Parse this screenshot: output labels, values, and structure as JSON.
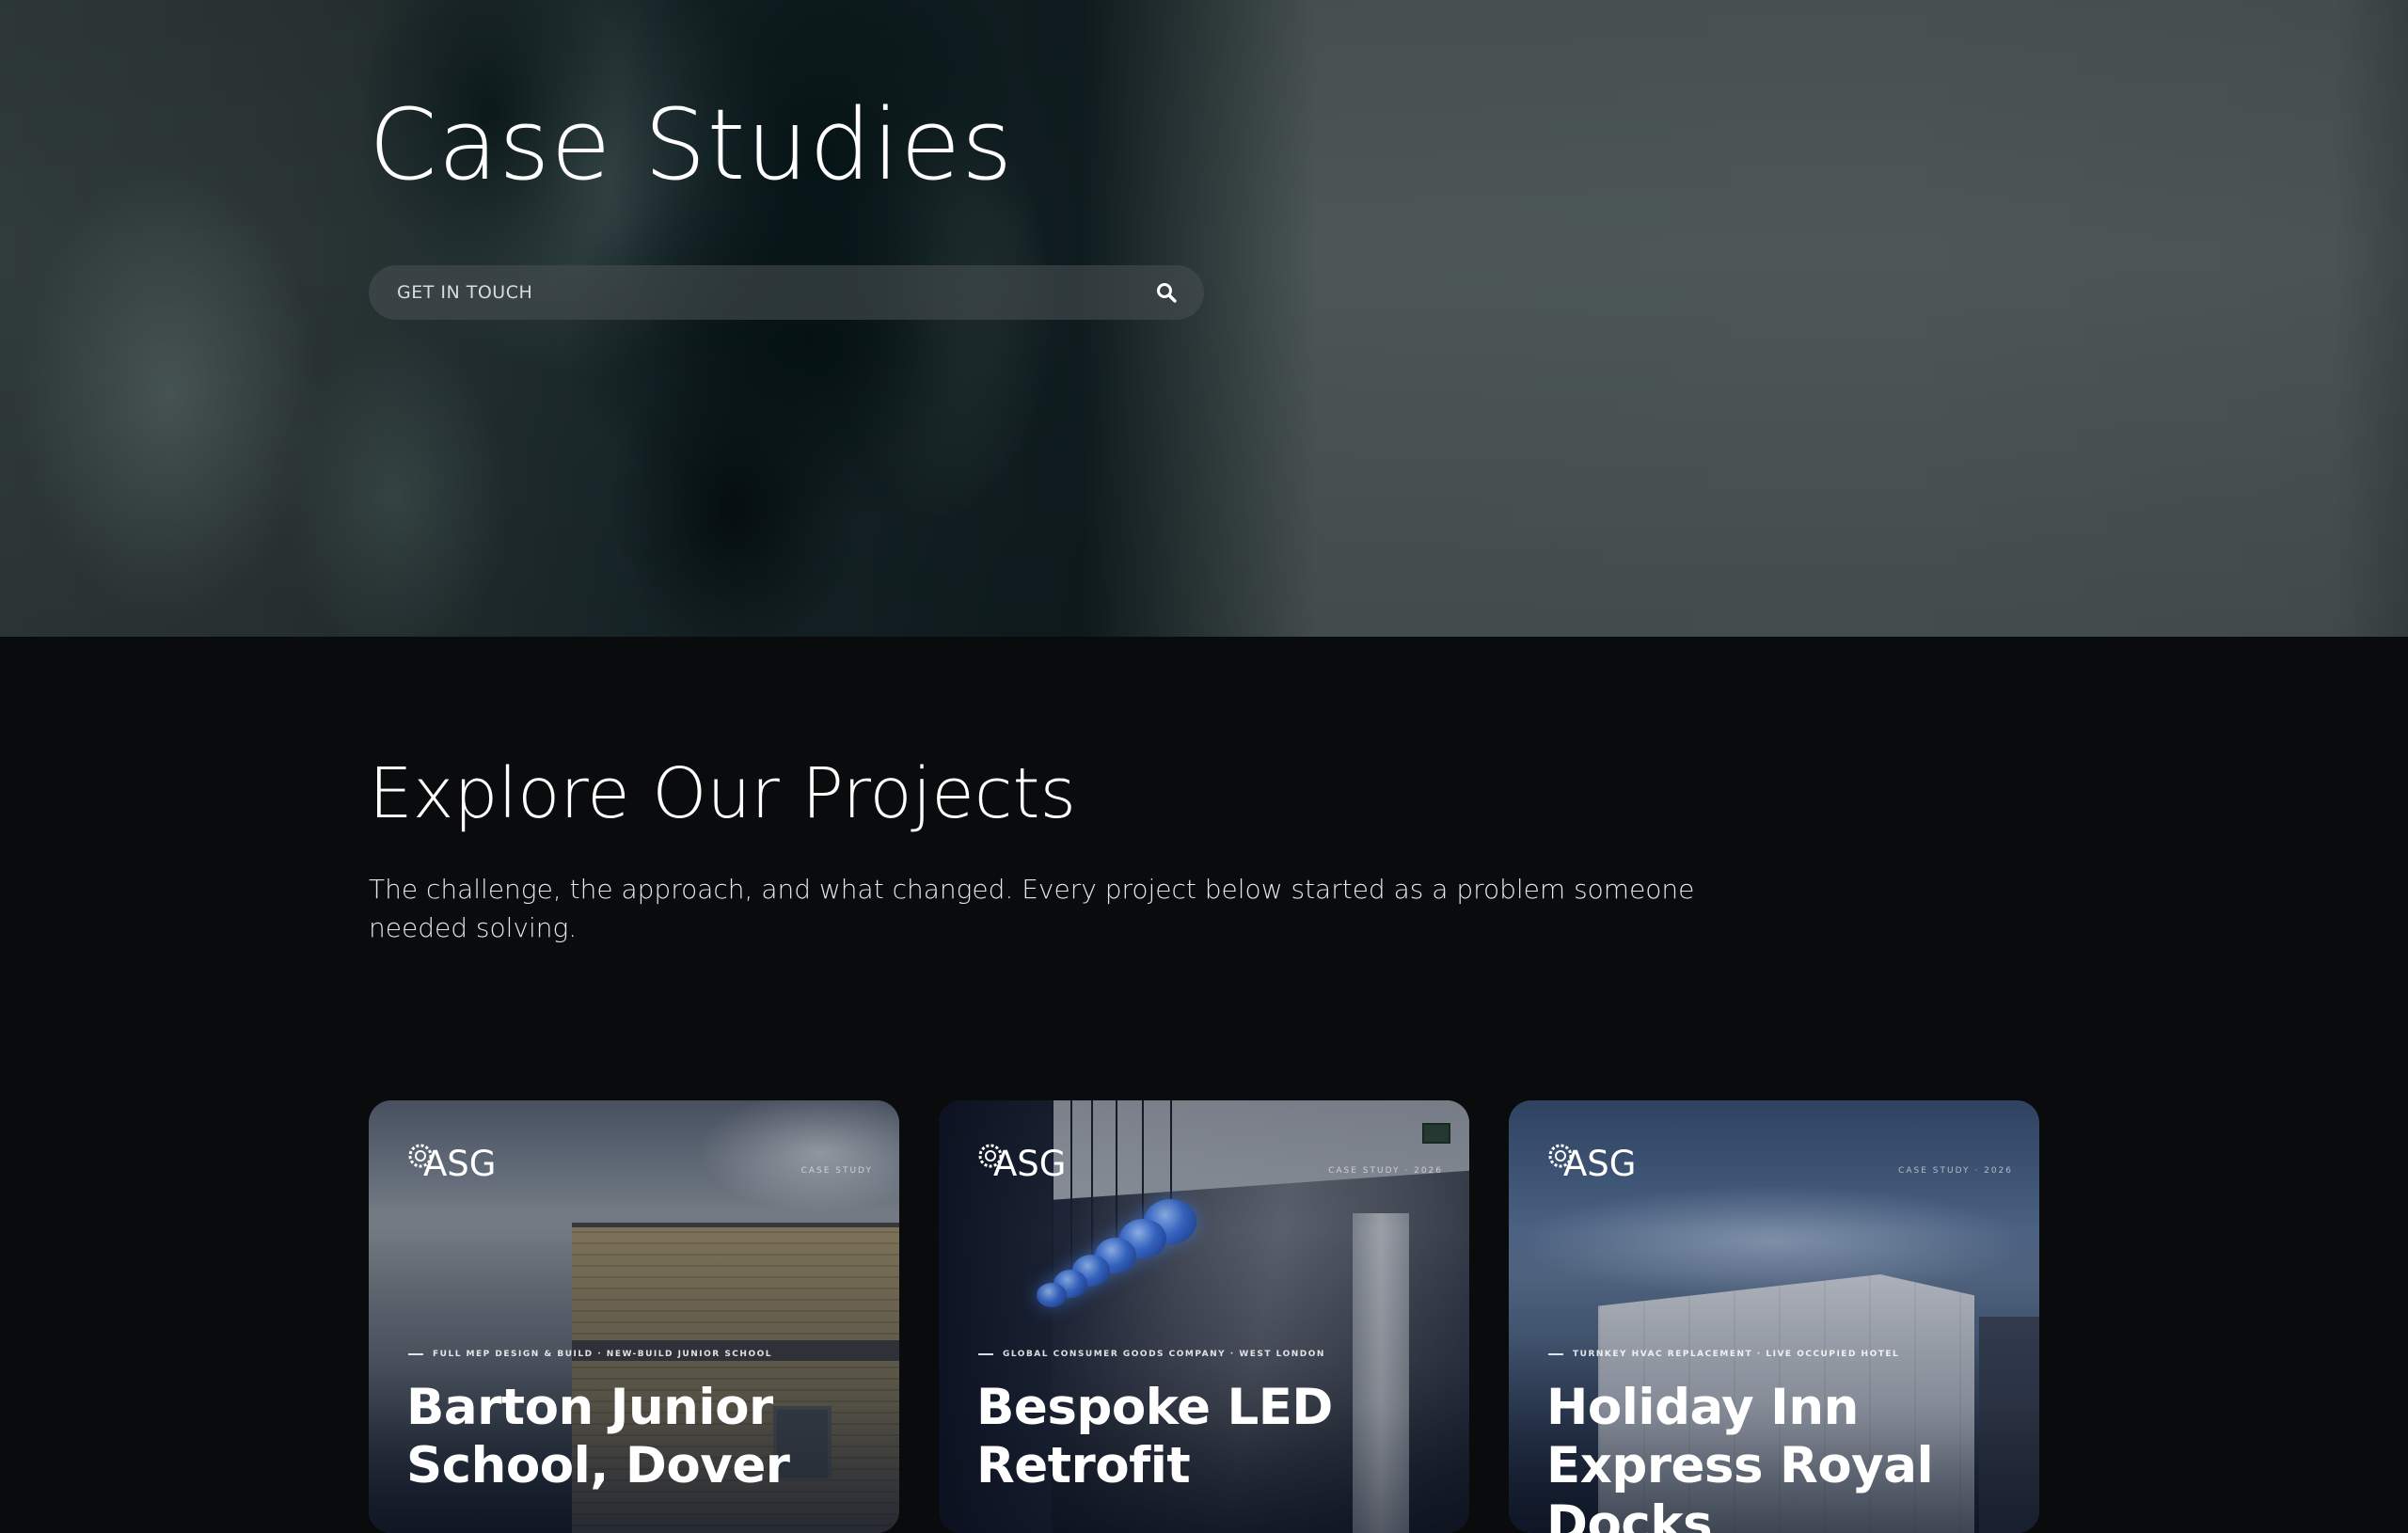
{
  "hero": {
    "title": "Case Studies",
    "search": {
      "placeholder": "GET IN TOUCH",
      "button_icon": "search-icon"
    }
  },
  "explore": {
    "title": "Explore Our Projects",
    "description": "The challenge, the approach, and what changed. Every project below started as a problem someone needed solving."
  },
  "cards": [
    {
      "logo": "ASG",
      "kicker": "CASE STUDY",
      "meta": "FULL MEP DESIGN & BUILD · NEW-BUILD JUNIOR SCHOOL",
      "title": "Barton Junior School, Dover"
    },
    {
      "logo": "ASG",
      "kicker": "CASE STUDY · 2026",
      "meta": "GLOBAL CONSUMER GOODS COMPANY · WEST LONDON",
      "title": "Bespoke LED Retrofit"
    },
    {
      "logo": "ASG",
      "kicker": "CASE STUDY · 2026",
      "meta": "TURNKEY HVAC REPLACEMENT · LIVE OCCUPIED HOTEL",
      "title": "Holiday Inn Express Royal Docks"
    }
  ],
  "colors": {
    "page_bg": "#0a0b0d",
    "text": "#ffffff",
    "search_bg": "#464e50"
  }
}
